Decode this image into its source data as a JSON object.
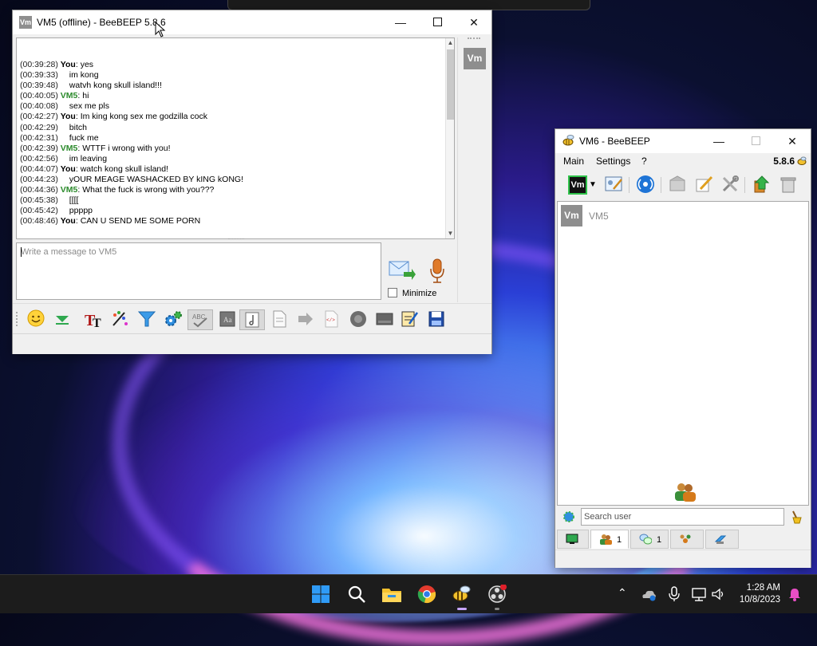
{
  "chat_window": {
    "title": "VM5 (offline) - BeeBEEP 5.8.6",
    "app_icon": "Vm",
    "messages": [
      {
        "time": "(00:39:28)",
        "sender": "You",
        "text": "yes"
      },
      {
        "time": "(00:39:33)",
        "sender": "",
        "text": "im kong"
      },
      {
        "time": "(00:39:48)",
        "sender": "",
        "text": "watvh kong skull island!!!"
      },
      {
        "time": "(00:40:05)",
        "sender": "VM5",
        "text": "hi"
      },
      {
        "time": "(00:40:08)",
        "sender": "",
        "text": "sex me pls"
      },
      {
        "time": "(00:42:27)",
        "sender": "You",
        "text": "Im king kong sex me godzilla cock"
      },
      {
        "time": "(00:42:29)",
        "sender": "",
        "text": "bitch"
      },
      {
        "time": "(00:42:31)",
        "sender": "",
        "text": "fuck me"
      },
      {
        "time": "(00:42:39)",
        "sender": "VM5",
        "text": "WTTF i wrong with you!"
      },
      {
        "time": "(00:42:56)",
        "sender": "",
        "text": "im leaving"
      },
      {
        "time": "(00:44:07)",
        "sender": "You",
        "text": "watch kong skull island!"
      },
      {
        "time": "(00:44:23)",
        "sender": "",
        "text": "yOUR MEAGE WASHACKED BY kING kONG!"
      },
      {
        "time": "(00:44:36)",
        "sender": "VM5",
        "text": "What the fuck is wrong with you???"
      },
      {
        "time": "(00:45:38)",
        "sender": "",
        "text": "[[[["
      },
      {
        "time": "(00:45:42)",
        "sender": "",
        "text": "ppppp"
      },
      {
        "time": "(00:48:46)",
        "sender": "You",
        "text": "CAN U SEND ME SOME PORN"
      }
    ],
    "input_placeholder": "Write a message to VM5",
    "minimize_label": "Minimize",
    "side_avatar": "Vm"
  },
  "user_window": {
    "title": "VM6 - BeeBEEP",
    "menu": [
      "Main",
      "Settings",
      "?"
    ],
    "version": "5.8.6",
    "toolbar_avatar": "Vm",
    "users": [
      {
        "avatar": "Vm",
        "name": "VM5"
      }
    ],
    "search_placeholder": "Search user",
    "tabs": [
      {
        "icon": "monitor-icon",
        "count": ""
      },
      {
        "icon": "users-icon",
        "count": "1"
      },
      {
        "icon": "chat-bubbles-icon",
        "count": "1"
      },
      {
        "icon": "group-icon",
        "count": ""
      },
      {
        "icon": "file-share-icon",
        "count": ""
      }
    ]
  },
  "taskbar": {
    "time": "1:28 AM",
    "date": "10/8/2023"
  }
}
